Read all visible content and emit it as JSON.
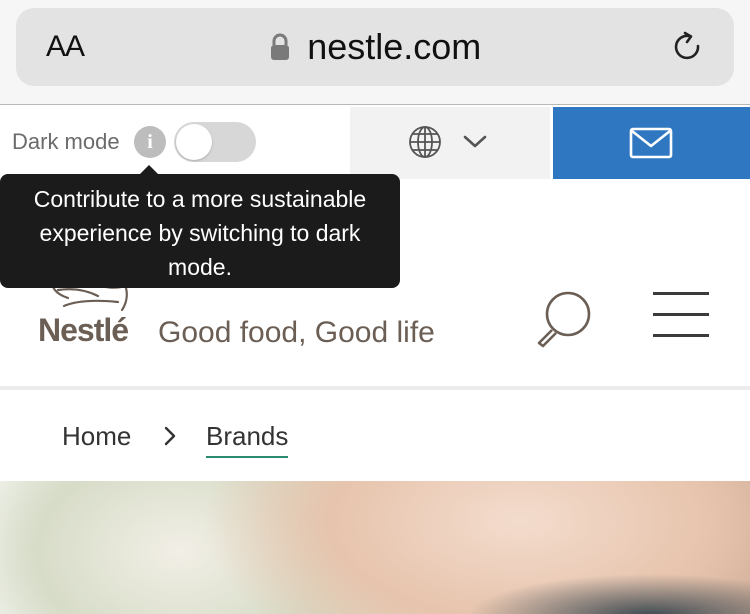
{
  "browser": {
    "text_size_label": "AA",
    "url": "nestle.com"
  },
  "utility": {
    "dark_mode_label": "Dark mode",
    "info_icon_text": "i",
    "dark_mode_tooltip": "Contribute to a more sustainable experience by switching to dark mode.",
    "dark_mode_enabled": false,
    "contact_button_color": "#2f78c1"
  },
  "header": {
    "brand_name": "Nestlé",
    "tagline": "Good food, Good life"
  },
  "breadcrumb": {
    "items": [
      "Home",
      "Brands"
    ],
    "separator": "›",
    "active_underline_color": "#2c8a6f"
  },
  "icons": [
    "lock-icon",
    "reload-icon",
    "info-icon",
    "globe-icon",
    "chevron-down-icon",
    "mail-icon",
    "search-icon",
    "menu-icon",
    "chevron-right-icon"
  ]
}
